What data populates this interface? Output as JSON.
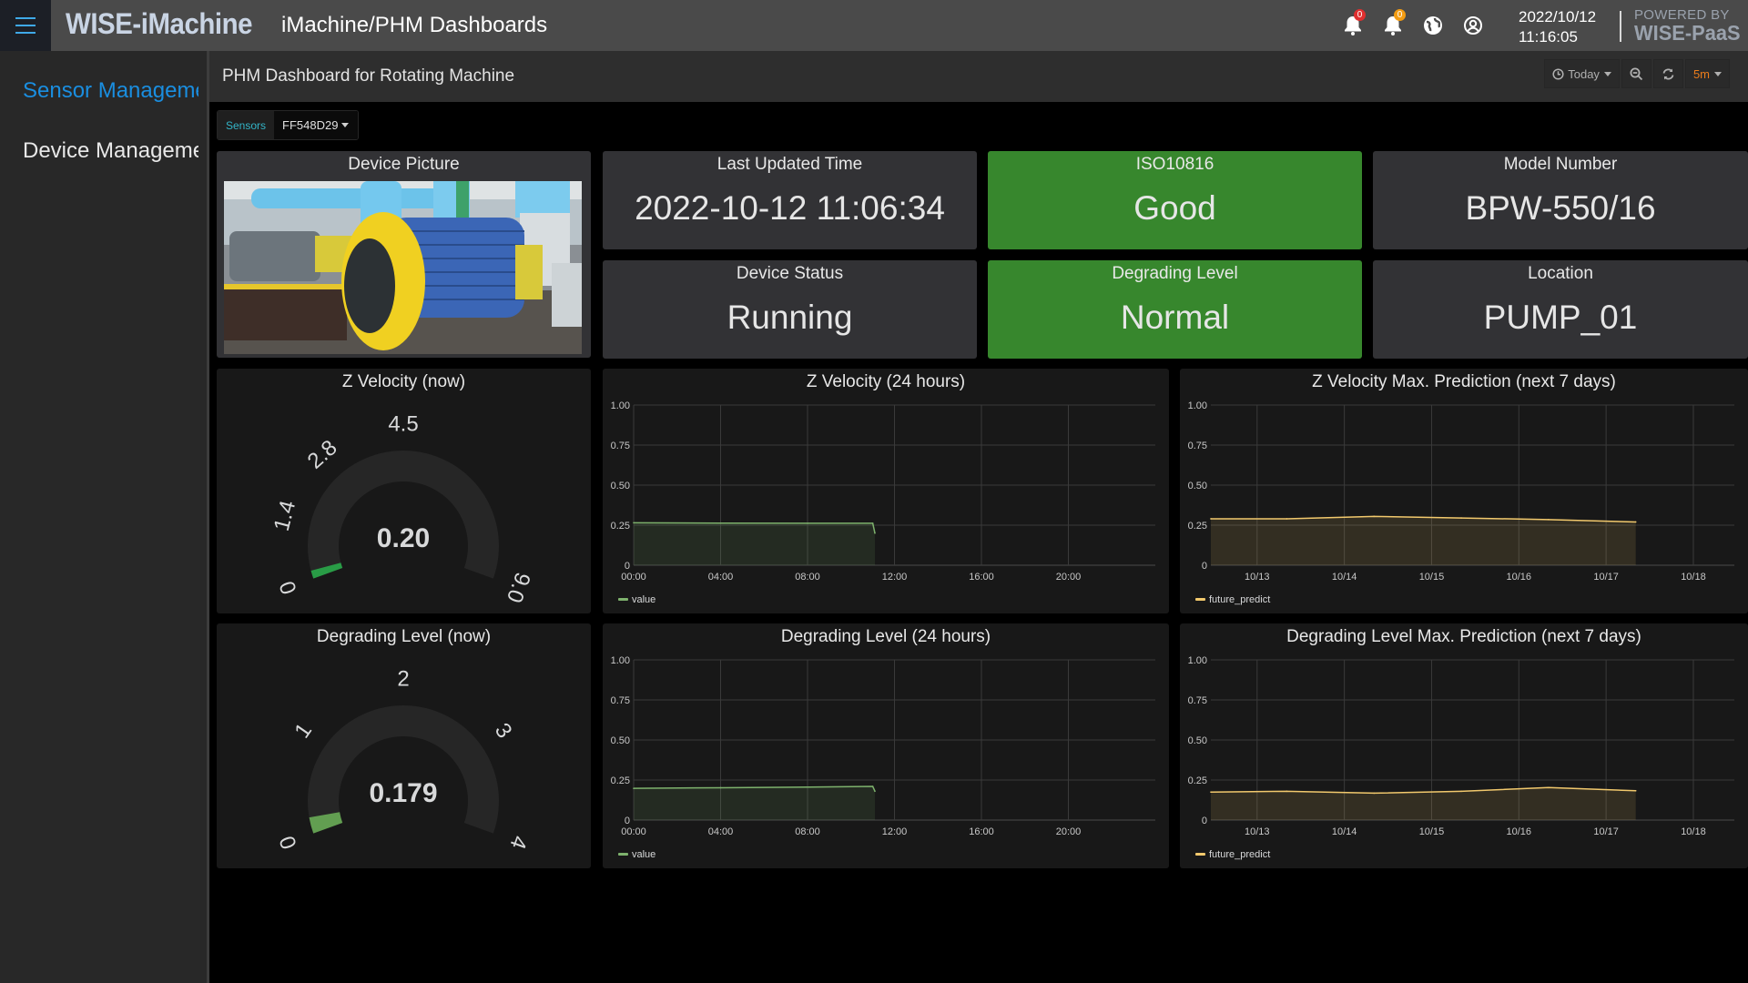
{
  "topbar": {
    "brand": "WISE-iMachine",
    "title": "iMachine/PHM Dashboards",
    "icons": [
      {
        "name": "alarm-bell-icon",
        "badge": "0",
        "badge_color": "#e02f2f"
      },
      {
        "name": "notification-bell-icon",
        "badge": "0",
        "badge_color": "#f39c12"
      },
      {
        "name": "globe-icon"
      },
      {
        "name": "user-account-icon"
      }
    ],
    "date": "2022/10/12",
    "time": "11:16:05",
    "powered_by": "POWERED BY",
    "platform": "WISE-PaaS"
  },
  "sidebar": {
    "items": [
      {
        "label": "Sensor Management",
        "active": true
      },
      {
        "label": "Device Management",
        "active": false
      }
    ]
  },
  "header": {
    "dashboard_title": "PHM Dashboard for Rotating Machine",
    "time_range": "Today",
    "refresh_interval": "5m"
  },
  "variables": {
    "label": "Sensors",
    "value": "FF548D29"
  },
  "panels": {
    "device_picture": {
      "title": "Device Picture"
    },
    "last_updated": {
      "title": "Last Updated Time",
      "value": "2022-10-12 11:06:34"
    },
    "iso10816": {
      "title": "ISO10816",
      "value": "Good",
      "color": "#37872d"
    },
    "model_number": {
      "title": "Model Number",
      "value": "BPW-550/16"
    },
    "device_status": {
      "title": "Device Status",
      "value": "Running"
    },
    "degrading_level": {
      "title": "Degrading Level",
      "value": "Normal",
      "color": "#37872d"
    },
    "location": {
      "title": "Location",
      "value": "PUMP_01"
    },
    "zvel_gauge": {
      "title": "Z Velocity (now)",
      "value": 0.2,
      "display": "0.20",
      "min": 0,
      "max": 9.0,
      "tick_labels": [
        "0",
        "1.4",
        "2.8",
        "4.5",
        "9.0"
      ],
      "tick_values": [
        0,
        1.4,
        2.8,
        4.5,
        9.0
      ],
      "color": "#299c46"
    },
    "deg_gauge": {
      "title": "Degrading Level (now)",
      "value": 0.179,
      "display": "0.179",
      "min": 0,
      "max": 4,
      "tick_labels": [
        "0",
        "1",
        "2",
        "3",
        "4"
      ],
      "tick_values": [
        0,
        1,
        2,
        3,
        4
      ],
      "color": "#629e51"
    }
  },
  "chart_data": [
    {
      "id": "zvel24",
      "type": "area",
      "title": "Z Velocity (24 hours)",
      "xlabel": "",
      "ylabel": "",
      "x_unit": "hour",
      "xlim": [
        0,
        24
      ],
      "ylim": [
        0,
        1
      ],
      "x_ticks": [
        0,
        4,
        8,
        12,
        16,
        20
      ],
      "x_tick_labels": [
        "00:00",
        "04:00",
        "08:00",
        "12:00",
        "16:00",
        "20:00"
      ],
      "y_ticks": [
        0,
        0.25,
        0.5,
        0.75,
        1.0
      ],
      "y_tick_labels": [
        "0",
        "0.25",
        "0.50",
        "0.75",
        "1.00"
      ],
      "grid": true,
      "legend": "bottom-left",
      "series": [
        {
          "name": "value",
          "color": "#7eb26d",
          "x": [
            0,
            4,
            8,
            11.0,
            11.1
          ],
          "y": [
            0.265,
            0.263,
            0.262,
            0.262,
            0.2
          ]
        }
      ]
    },
    {
      "id": "zvelpred",
      "type": "area",
      "title": "Z Velocity Max. Prediction (next 7 days)",
      "xlabel": "",
      "ylabel": "",
      "x_unit": "day (October 2022)",
      "xlim": [
        12.47,
        18.47
      ],
      "ylim": [
        0,
        1
      ],
      "x_ticks": [
        13,
        14,
        15,
        16,
        17,
        18
      ],
      "x_tick_labels": [
        "10/13",
        "10/14",
        "10/15",
        "10/16",
        "10/17",
        "10/18"
      ],
      "y_ticks": [
        0,
        0.25,
        0.5,
        0.75,
        1.0
      ],
      "y_tick_labels": [
        "0",
        "0.25",
        "0.50",
        "0.75",
        "1.00"
      ],
      "grid": true,
      "legend": "bottom-left",
      "series": [
        {
          "name": "future_predict",
          "color": "#f2c96d",
          "x": [
            12.47,
            13.34,
            14.34,
            15.34,
            16.34,
            17.34
          ],
          "y": [
            0.29,
            0.29,
            0.305,
            0.295,
            0.285,
            0.27
          ]
        }
      ]
    },
    {
      "id": "deg24",
      "type": "area",
      "title": "Degrading Level (24 hours)",
      "xlabel": "",
      "ylabel": "",
      "x_unit": "hour",
      "xlim": [
        0,
        24
      ],
      "ylim": [
        0,
        1
      ],
      "x_ticks": [
        0,
        4,
        8,
        12,
        16,
        20
      ],
      "x_tick_labels": [
        "00:00",
        "04:00",
        "08:00",
        "12:00",
        "16:00",
        "20:00"
      ],
      "y_ticks": [
        0,
        0.25,
        0.5,
        0.75,
        1.0
      ],
      "y_tick_labels": [
        "0",
        "0.25",
        "0.50",
        "0.75",
        "1.00"
      ],
      "grid": true,
      "legend": "bottom-left",
      "series": [
        {
          "name": "value",
          "color": "#7eb26d",
          "x": [
            0,
            4,
            8,
            11.0,
            11.1
          ],
          "y": [
            0.198,
            0.202,
            0.206,
            0.21,
            0.18
          ]
        }
      ]
    },
    {
      "id": "degpred",
      "type": "area",
      "title": "Degrading Level Max. Prediction (next 7 days)",
      "xlabel": "",
      "ylabel": "",
      "x_unit": "day (October 2022)",
      "xlim": [
        12.47,
        18.47
      ],
      "ylim": [
        0,
        1
      ],
      "x_ticks": [
        13,
        14,
        15,
        16,
        17,
        18
      ],
      "x_tick_labels": [
        "10/13",
        "10/14",
        "10/15",
        "10/16",
        "10/17",
        "10/18"
      ],
      "y_ticks": [
        0,
        0.25,
        0.5,
        0.75,
        1.0
      ],
      "y_tick_labels": [
        "0",
        "0.25",
        "0.50",
        "0.75",
        "1.00"
      ],
      "grid": true,
      "legend": "bottom-left",
      "series": [
        {
          "name": "future_predict",
          "color": "#f2c96d",
          "x": [
            12.47,
            13.34,
            14.34,
            15.34,
            16.34,
            17.34
          ],
          "y": [
            0.175,
            0.18,
            0.168,
            0.18,
            0.203,
            0.183
          ]
        }
      ]
    }
  ]
}
